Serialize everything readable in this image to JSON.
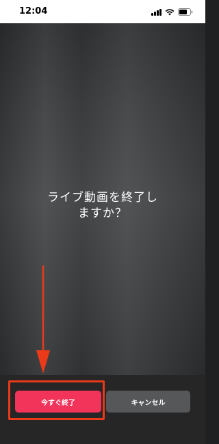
{
  "status_bar": {
    "time": "12:04",
    "icons": [
      "cellular-signal-icon",
      "wifi-icon",
      "battery-icon"
    ]
  },
  "dialog": {
    "question_line1": "ライブ動画を終了し",
    "question_line2": "ますか？"
  },
  "buttons": {
    "end_now_label": "今すぐ終了",
    "cancel_label": "キャンセル"
  },
  "annotation": {
    "color": "#ea3a1a",
    "arrow_icon": "down-arrow-icon"
  },
  "colors": {
    "end_button": "#f2335a",
    "cancel_button": "#555758"
  }
}
